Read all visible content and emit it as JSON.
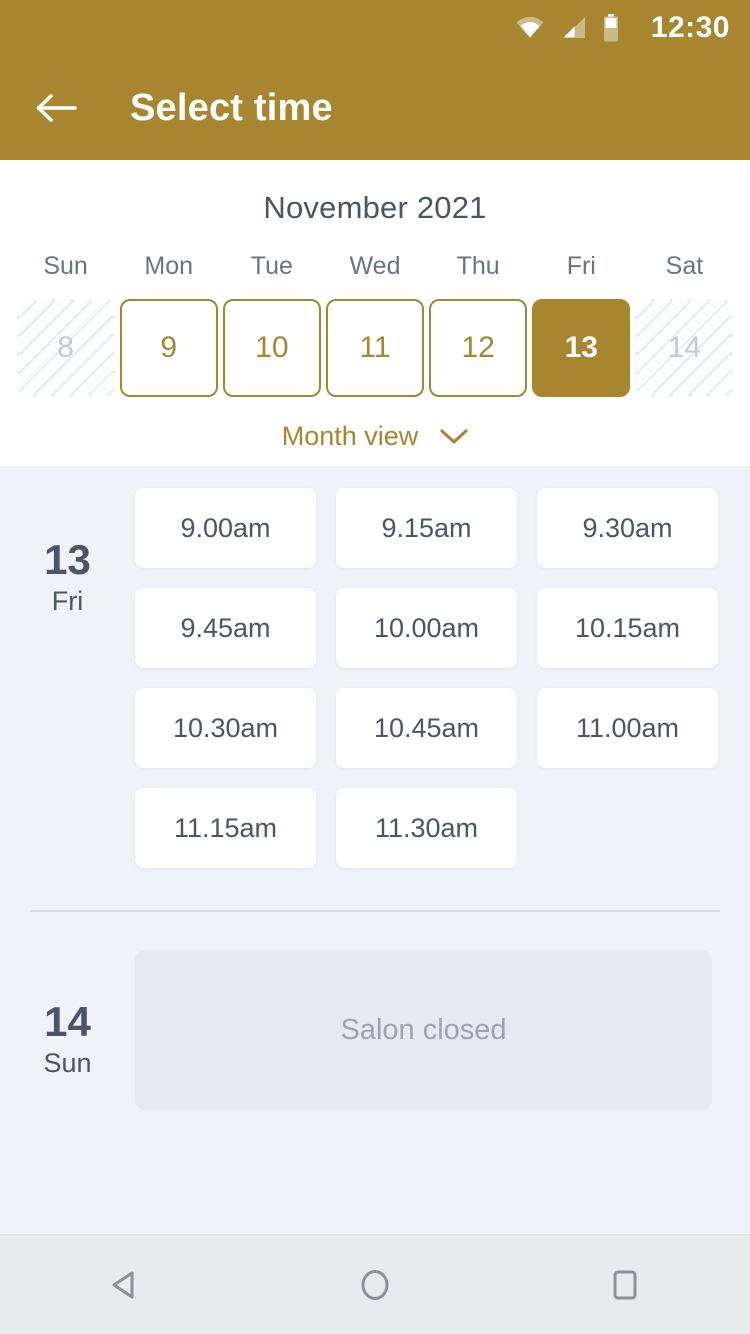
{
  "status_bar": {
    "time": "12:30",
    "icons": [
      "wifi-icon",
      "signal-icon",
      "battery-icon"
    ]
  },
  "app_bar": {
    "back_icon": "arrow-left-icon",
    "title": "Select time"
  },
  "calendar": {
    "month_title": "November 2021",
    "day_headers": [
      "Sun",
      "Mon",
      "Tue",
      "Wed",
      "Thu",
      "Fri",
      "Sat"
    ],
    "dates": [
      {
        "day": "8",
        "state": "disabled"
      },
      {
        "day": "9",
        "state": "available"
      },
      {
        "day": "10",
        "state": "available"
      },
      {
        "day": "11",
        "state": "available"
      },
      {
        "day": "12",
        "state": "available"
      },
      {
        "day": "13",
        "state": "selected"
      },
      {
        "day": "14",
        "state": "disabled"
      }
    ],
    "month_view_label": "Month view",
    "month_view_icon": "chevron-down-icon"
  },
  "schedule": {
    "days": [
      {
        "date_number": "13",
        "weekday": "Fri",
        "slots": [
          "9.00am",
          "9.15am",
          "9.30am",
          "9.45am",
          "10.00am",
          "10.15am",
          "10.30am",
          "10.45am",
          "11.00am",
          "11.15am",
          "11.30am"
        ]
      },
      {
        "date_number": "14",
        "weekday": "Sun",
        "closed_message": "Salon closed"
      }
    ]
  },
  "nav_bar": {
    "back_icon": "nav-back-triangle-icon",
    "home_icon": "nav-home-circle-icon",
    "recents_icon": "nav-recents-square-icon"
  },
  "colors": {
    "accent": "#a8852f",
    "text_dark": "#4a556b",
    "background": "#eff2f7",
    "card": "#ffffff",
    "disabled_text": "#c3c9d6"
  }
}
